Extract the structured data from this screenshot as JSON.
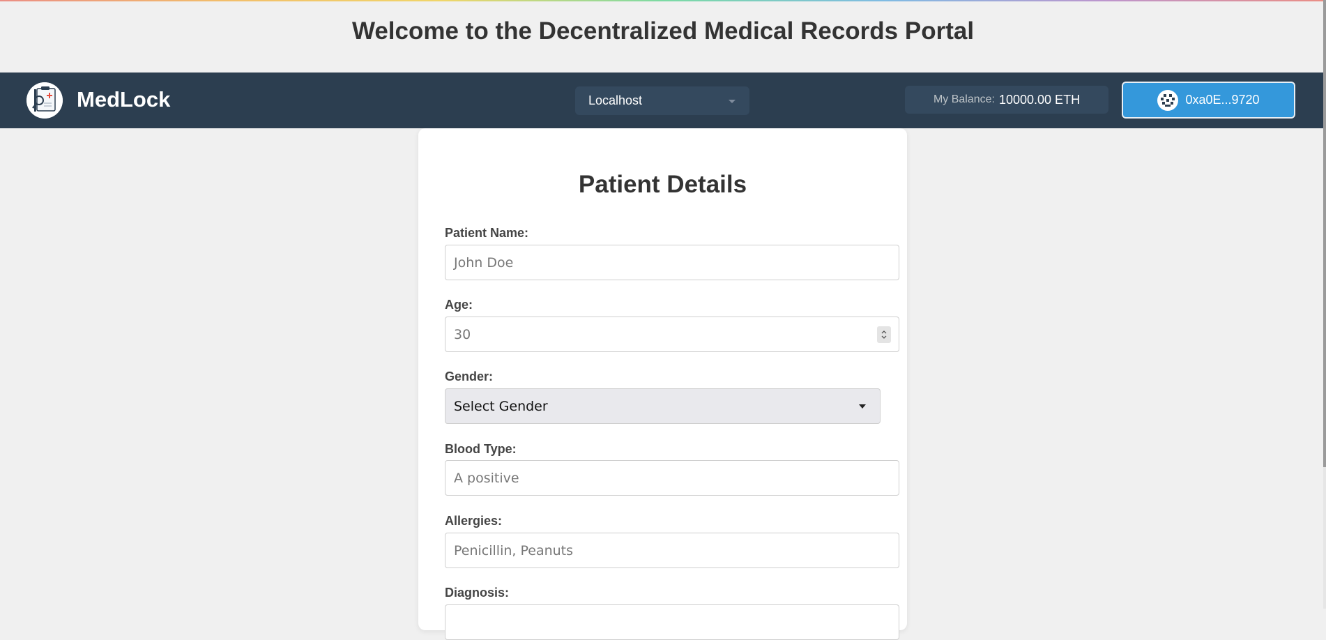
{
  "page": {
    "title": "Welcome to the Decentralized Medical Records Portal"
  },
  "navbar": {
    "brand": "MedLock",
    "logo_icon": "medical-clipboard-magnifier-icon",
    "network": "Localhost",
    "balance_label": "My Balance:",
    "balance_value": "10000.00 ETH",
    "account_address": "0xa0E...9720",
    "account_icon": "identicon-avatar-icon",
    "colors": {
      "navbar_bg": "#2c3e50",
      "panel_bg": "#34495e",
      "accent": "#3498db"
    }
  },
  "form": {
    "title": "Patient Details",
    "fields": [
      {
        "label": "Patient Name:",
        "placeholder": "John Doe",
        "type": "text"
      },
      {
        "label": "Age:",
        "placeholder": "30",
        "type": "number"
      },
      {
        "label": "Gender:",
        "value": "Select Gender",
        "type": "select"
      },
      {
        "label": "Blood Type:",
        "placeholder": "A positive",
        "type": "text"
      },
      {
        "label": "Allergies:",
        "placeholder": "Penicillin, Peanuts",
        "type": "text"
      },
      {
        "label": "Diagnosis:",
        "type": "text"
      }
    ]
  }
}
